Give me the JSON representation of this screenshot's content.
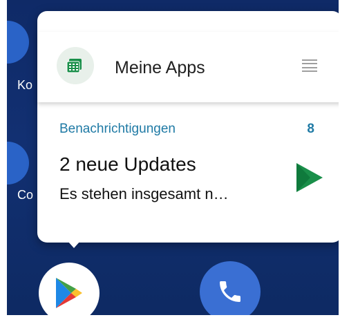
{
  "home": {
    "bg_label_1": "Ko",
    "bg_label_2": "Co"
  },
  "popup": {
    "shortcut": {
      "label": "Meine Apps",
      "icon": "grid-apps-icon"
    },
    "notifications": {
      "header": "Benachrichtigungen",
      "count": "8",
      "title": "2 neue Updates",
      "text": "Es stehen insgesamt n…",
      "icon": "play-store-icon"
    }
  },
  "dock": {
    "play_store_icon": "play-store-icon",
    "phone_icon": "phone-icon"
  },
  "colors": {
    "wallpaper": "#123072",
    "accent": "#1f7aa5",
    "play_green": "#1a8f4a",
    "phone_blue": "#3a6fd3"
  }
}
